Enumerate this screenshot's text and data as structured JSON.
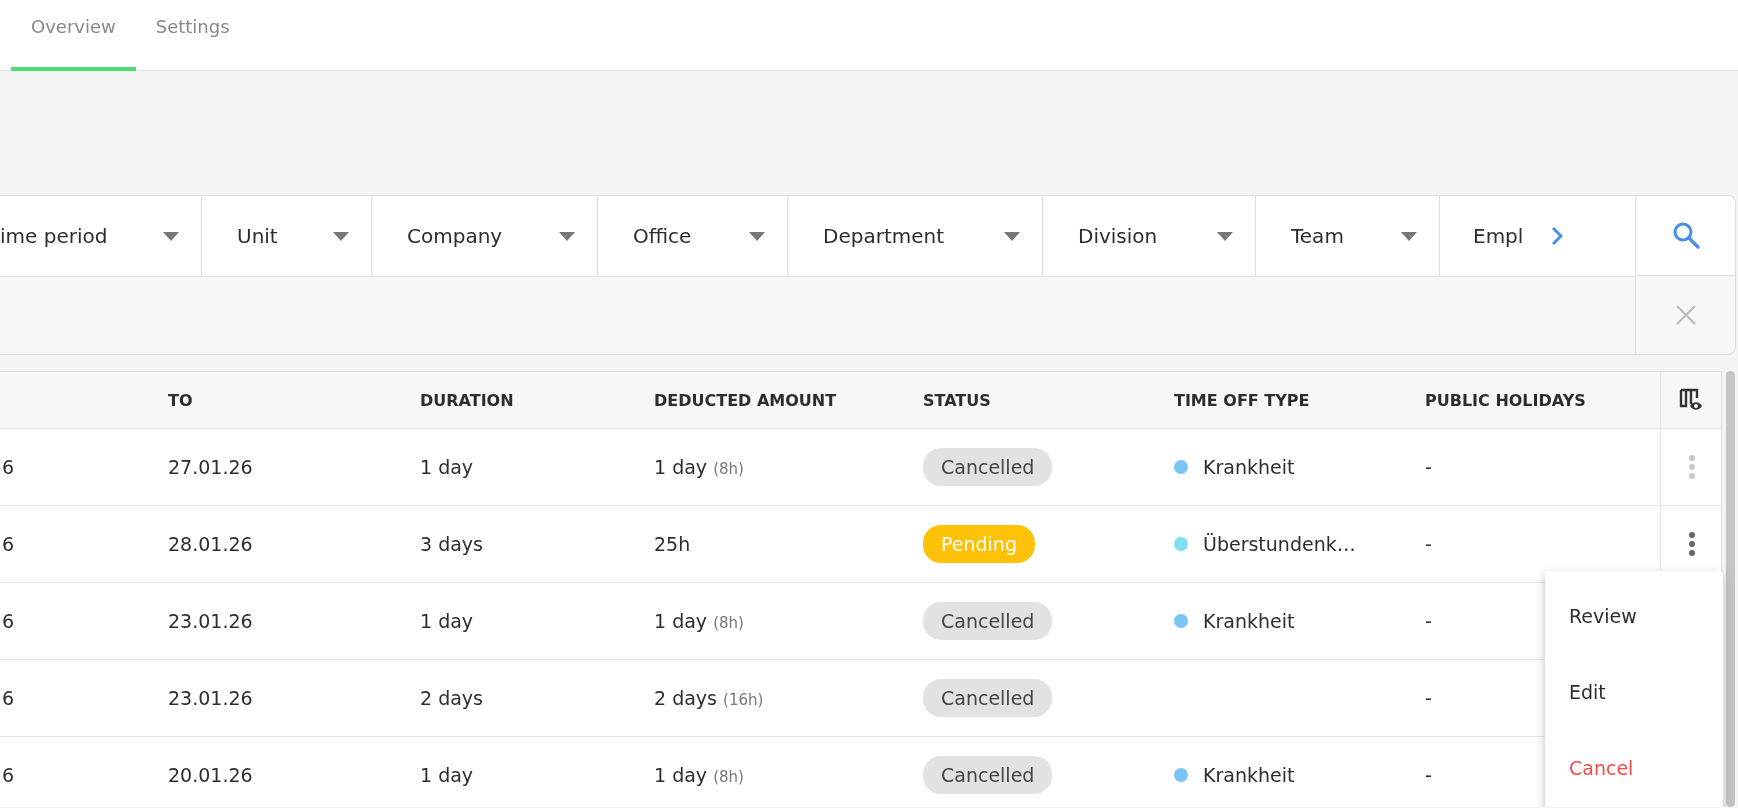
{
  "tabs": [
    {
      "label": "Overview",
      "selected": true
    },
    {
      "label": "Settings",
      "selected": false
    }
  ],
  "filters": [
    {
      "label": "ime period",
      "kind": "dropdown"
    },
    {
      "label": "Unit",
      "kind": "dropdown"
    },
    {
      "label": "Company",
      "kind": "dropdown"
    },
    {
      "label": "Office",
      "kind": "dropdown"
    },
    {
      "label": "Department",
      "kind": "dropdown"
    },
    {
      "label": "Division",
      "kind": "dropdown"
    },
    {
      "label": "Team",
      "kind": "dropdown"
    },
    {
      "label": "Empl",
      "kind": "overflow"
    }
  ],
  "table": {
    "columns": [
      "TO",
      "DURATION",
      "DEDUCTED AMOUNT",
      "STATUS",
      "TIME OFF TYPE",
      "PUBLIC HOLIDAYS"
    ],
    "rows": [
      {
        "column_1": "6",
        "to": "27.01.26",
        "duration": "1 day",
        "deducted": "1 day",
        "deducted_hours": "(8h)",
        "status": {
          "label": "Cancelled",
          "kind": "cancelled"
        },
        "type": {
          "label": "Krankheit",
          "color": "#7cc3f5"
        },
        "holidays": "-",
        "actions": {
          "open": false
        }
      },
      {
        "column_1": "6",
        "to": "28.01.26",
        "duration": "3 days",
        "deducted": "25h",
        "status": {
          "label": "Pending",
          "kind": "pending"
        },
        "type": {
          "label": "Überstundenk…",
          "color": "#82def7"
        },
        "holidays": "-",
        "actions": {
          "open": true
        }
      },
      {
        "column_1": "6",
        "to": "23.01.26",
        "duration": "1 day",
        "deducted": "1 day",
        "deducted_hours": "(8h)",
        "status": {
          "label": "Cancelled",
          "kind": "cancelled"
        },
        "type": {
          "label": "Krankheit",
          "color": "#7cc3f5"
        },
        "holidays": "-"
      },
      {
        "column_1": "6",
        "to": "23.01.26",
        "duration": "2 days",
        "deducted": "2 days",
        "deducted_hours": "(16h)",
        "status": {
          "label": "Cancelled",
          "kind": "cancelled"
        },
        "holidays": "-"
      },
      {
        "column_1": "6",
        "to": "20.01.26",
        "duration": "1 day",
        "deducted": "1 day",
        "deducted_hours": "(8h)",
        "status": {
          "label": "Cancelled",
          "kind": "cancelled"
        },
        "type": {
          "label": "Krankheit",
          "color": "#7cc3f5"
        },
        "holidays": "-"
      }
    ]
  },
  "menu": [
    {
      "label": "Review",
      "kind": "normal"
    },
    {
      "label": "Edit",
      "kind": "normal"
    },
    {
      "label": "Cancel",
      "kind": "danger"
    }
  ]
}
